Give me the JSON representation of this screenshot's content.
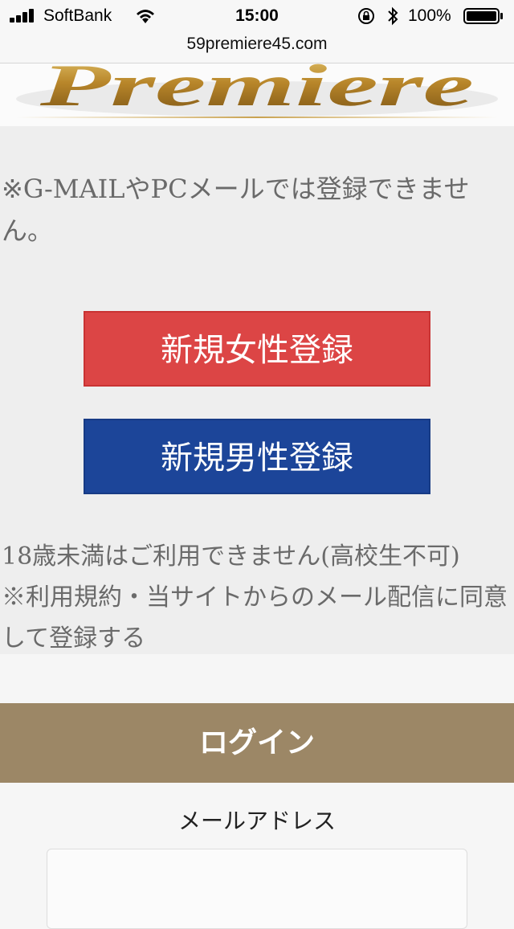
{
  "status_bar": {
    "carrier": "SoftBank",
    "time": "15:00",
    "battery_percent": "100%"
  },
  "url_bar": {
    "url": "59premiere45.com"
  },
  "header": {
    "logo_text": "Premiere",
    "logo_color": "#b8862a"
  },
  "info": {
    "notice": "※G-MAILやPCメールでは登録できません。",
    "register_female_label": "新規女性登録",
    "register_male_label": "新規男性登録",
    "age_notice": "18歳未満はご利用できません(高校生不可)",
    "terms_notice": "※利用規約・当サイトからのメール配信に同意して登録する"
  },
  "colors": {
    "female_button": "#dc4545",
    "male_button": "#1c4599",
    "login_header": "#9c8766"
  },
  "login": {
    "title": "ログイン",
    "email_label": "メールアドレス",
    "email_value": ""
  }
}
